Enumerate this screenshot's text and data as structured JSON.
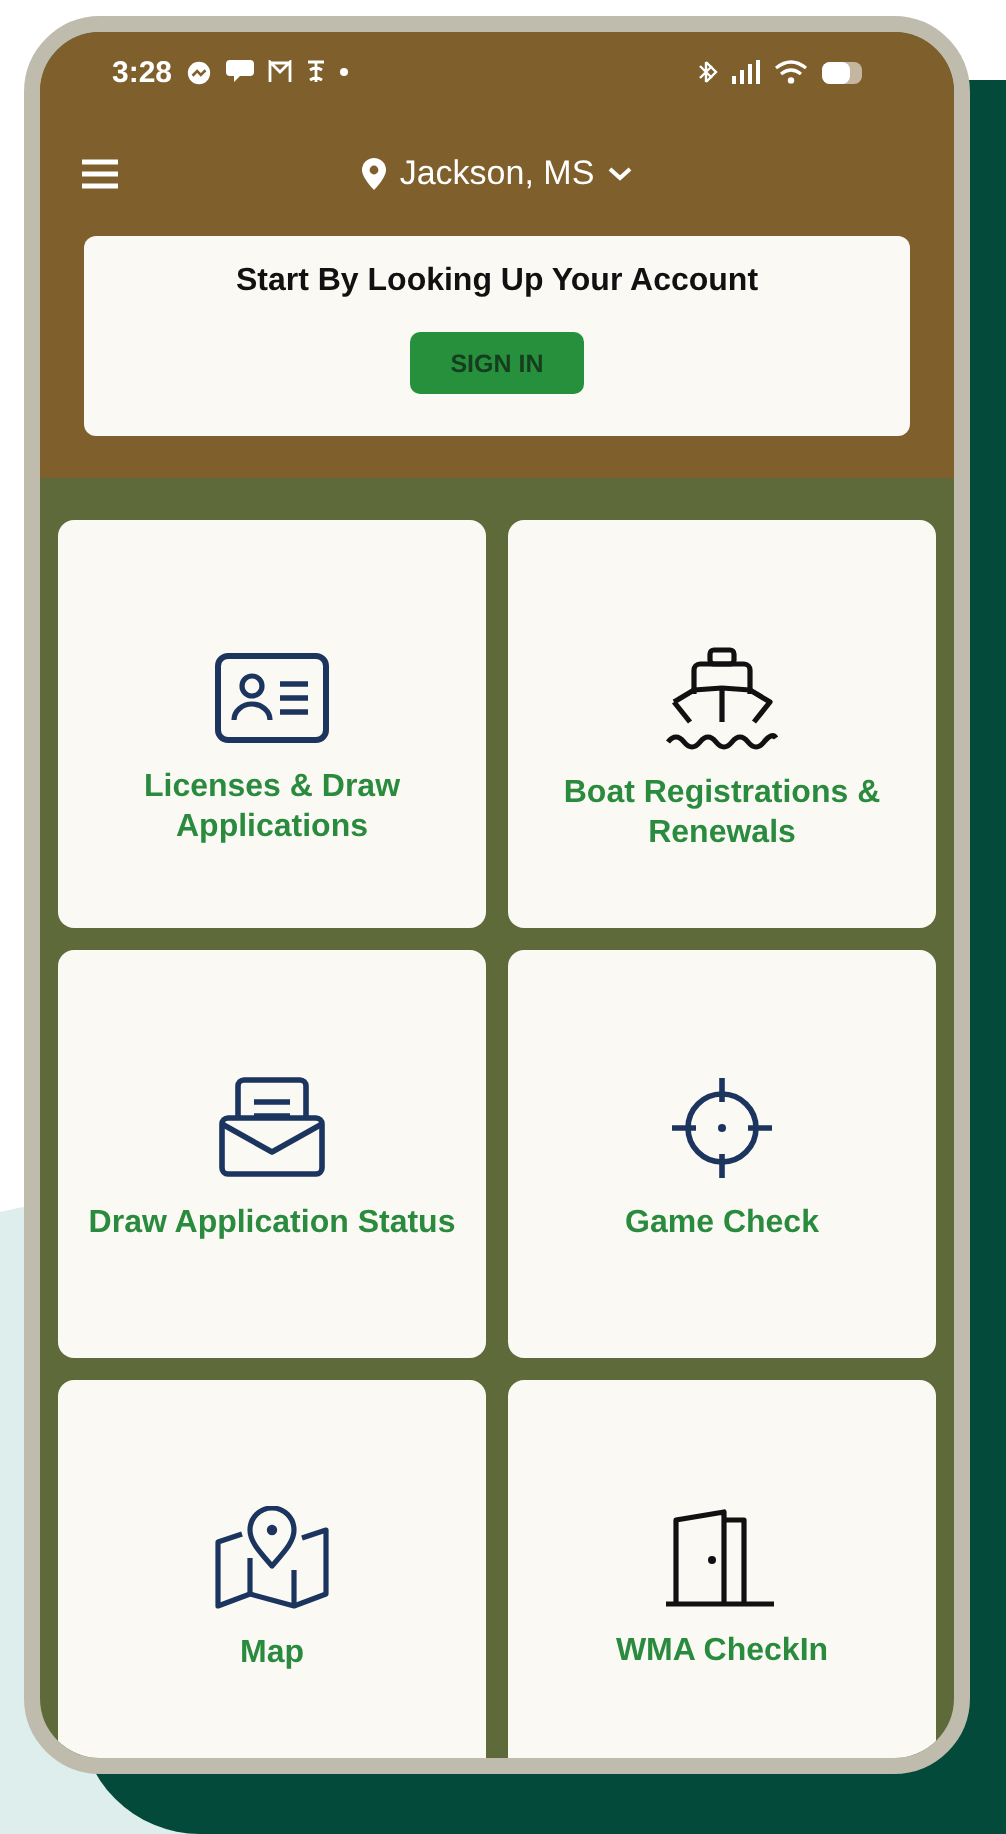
{
  "status_bar": {
    "time": "3:28"
  },
  "header": {
    "location": "Jackson, MS"
  },
  "account_card": {
    "title": "Start By Looking Up Your Account",
    "button": "SIGN IN"
  },
  "tiles": [
    {
      "kind": "id-card",
      "label": "Licenses & Draw Applications"
    },
    {
      "kind": "ship",
      "label": "Boat Registrations & Renewals"
    },
    {
      "kind": "envelope",
      "label": "Draw Application Status"
    },
    {
      "kind": "crosshair",
      "label": "Game Check"
    },
    {
      "kind": "map",
      "label": "Map"
    },
    {
      "kind": "door",
      "label": "WMA CheckIn"
    }
  ]
}
